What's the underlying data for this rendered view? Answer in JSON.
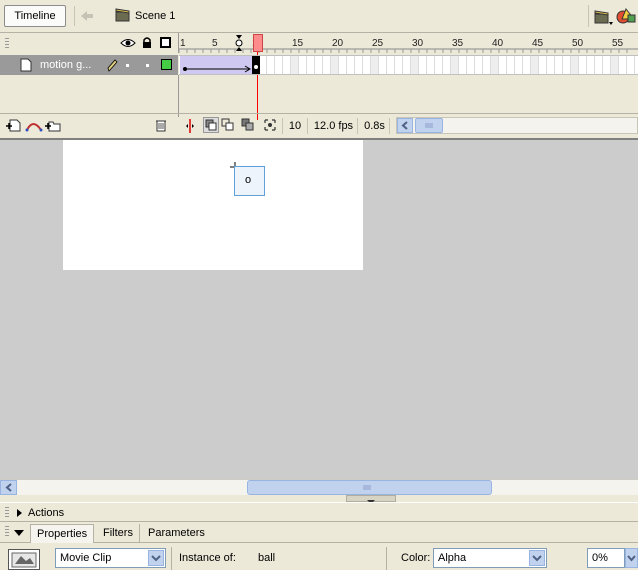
{
  "toolbar": {
    "timeline_button": "Timeline",
    "scene_label": "Scene 1"
  },
  "timeline": {
    "frame_ticks": [
      "1",
      "5",
      "10",
      "15",
      "20",
      "25",
      "30",
      "35",
      "40",
      "45",
      "50",
      "55"
    ],
    "layers": [
      {
        "name": "motion g...",
        "color": "#44cc44"
      }
    ],
    "status": {
      "current_frame": "10",
      "frame_rate": "12.0 fps",
      "elapsed_time": "0.8s"
    },
    "playhead_color": "#ff6666"
  },
  "stage": {
    "instance_marker": "o"
  },
  "panels": {
    "actions_title": "Actions",
    "tabs": [
      {
        "label": "Properties",
        "active": true
      },
      {
        "label": "Filters",
        "active": false
      },
      {
        "label": "Parameters",
        "active": false
      }
    ]
  },
  "properties": {
    "symbol_type": "Movie Clip",
    "instance_of_label": "Instance of:",
    "instance_of_value": "ball",
    "color_label": "Color:",
    "color_value": "Alpha",
    "alpha_value": "0%"
  }
}
